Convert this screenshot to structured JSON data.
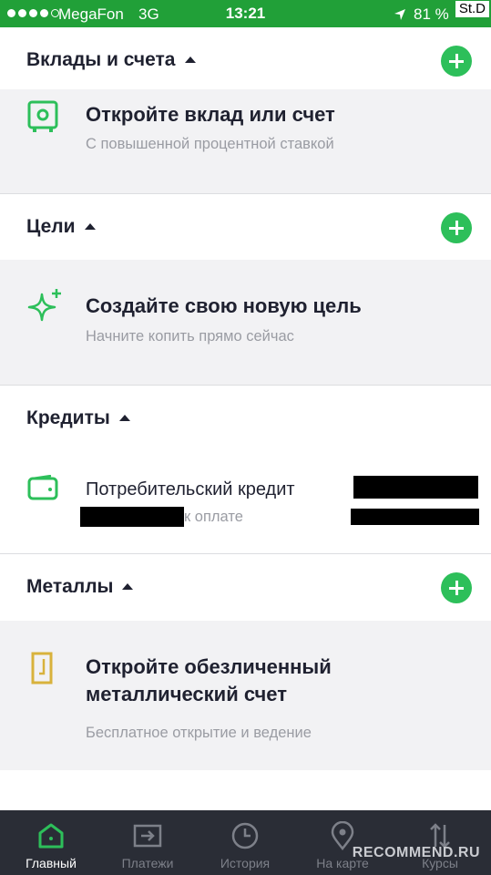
{
  "status_bar": {
    "carrier": "MegaFon",
    "network": "3G",
    "time": "13:21",
    "battery": "81 %",
    "watermark": "St.D"
  },
  "deposits": {
    "header": "Вклады и счета",
    "card_title": "Откройте вклад или счет",
    "card_subtitle": "С повышенной процентной ставкой",
    "icon": "safe-icon"
  },
  "goals": {
    "header": "Цели",
    "card_title": "Создайте свою новую цель",
    "card_subtitle": "Начните копить прямо сейчас",
    "icon": "sparkle-icon"
  },
  "credits": {
    "header": "Кредиты",
    "item_title": "Потребительский кредит",
    "item_subtitle": "к оплате",
    "icon": "wallet-icon"
  },
  "metals": {
    "header": "Металлы",
    "card_title_line1": "Откройте обезличенный",
    "card_title_line2": "металлический счет",
    "card_subtitle": "Бесплатное открытие и ведение",
    "icon": "gold-bar-icon"
  },
  "tab_bar": {
    "tabs": [
      {
        "label": "Главный",
        "icon": "home-icon",
        "active": true
      },
      {
        "label": "Платежи",
        "icon": "transfer-icon",
        "active": false
      },
      {
        "label": "История",
        "icon": "clock-icon",
        "active": false
      },
      {
        "label": "На карте",
        "icon": "map-pin-icon",
        "active": false
      },
      {
        "label": "Курсы",
        "icon": "exchange-arrows-icon",
        "active": false
      }
    ],
    "overlay_watermark": "RECOMMEND.RU"
  },
  "colors": {
    "brand_green": "#21a038",
    "accent_green": "#2dbf5a",
    "gold": "#d8b23c",
    "tab_bar_bg": "#2a2d36"
  }
}
